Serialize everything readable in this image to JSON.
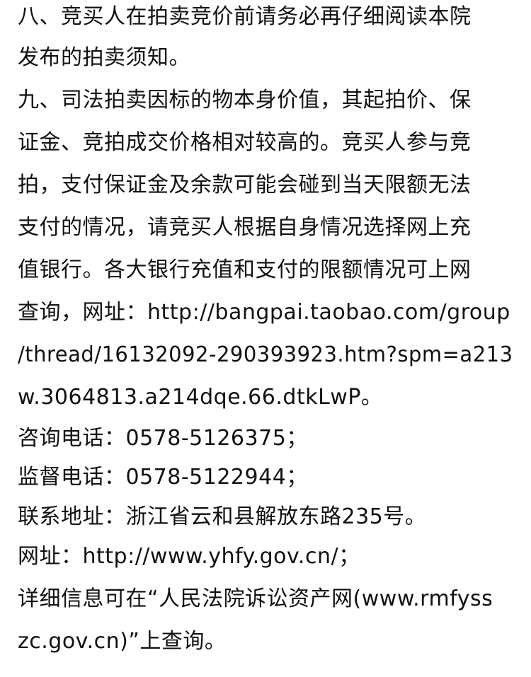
{
  "document": {
    "lines": [
      "八、竞买人在拍卖竞价前请务必再仔细阅读本院",
      "发布的拍卖须知。",
      "九、司法拍卖因标的物本身价值，其起拍价、保",
      "证金、竞拍成交价格相对较高的。竞买人参与竞",
      "拍，支付保证金及余款可能会碰到当天限额无法",
      "支付的情况，请竞买人根据自身情况选择网上充",
      "值银行。各大银行充值和支付的限额情况可上网",
      "查询，网址：http://bangpai.taobao.com/group",
      "/thread/16132092-290393923.htm?spm=a213",
      "w.3064813.a214dqe.66.dtkLwP。",
      "咨询电话：0578-5126375；",
      "监督电话：0578-5122944；",
      "联系地址：浙江省云和县解放东路235号。",
      "网址：http://www.yhfy.gov.cn/；",
      "详细信息可在“人民法院诉讼资产网(www.rmfyss",
      "zc.gov.cn)”上查询。"
    ]
  }
}
